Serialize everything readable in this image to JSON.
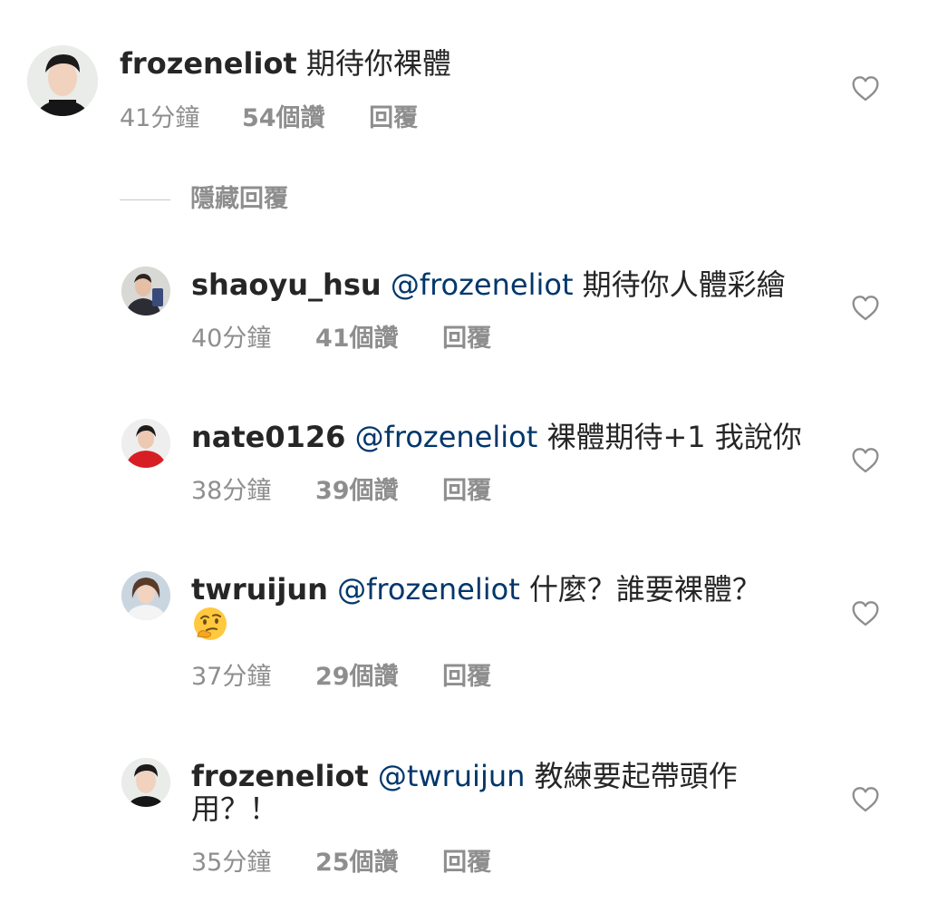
{
  "comments": [
    {
      "username": "frozeneliot",
      "mention": "",
      "text": "期待你裸體",
      "time": "41分鐘",
      "likes": "54個讚",
      "reply": "回覆",
      "avatar": "avatar-frozeneliot"
    },
    {
      "username": "shaoyu_hsu",
      "mention": "@frozeneliot",
      "text": "期待你人體彩繪",
      "time": "40分鐘",
      "likes": "41個讚",
      "reply": "回覆",
      "avatar": "avatar-shaoyu_hsu"
    },
    {
      "username": "nate0126",
      "mention": "@frozeneliot",
      "text": "裸體期待+1 我說你",
      "time": "38分鐘",
      "likes": "39個讚",
      "reply": "回覆",
      "avatar": "avatar-nate0126"
    },
    {
      "username": "twruijun",
      "mention": "@frozeneliot",
      "text": "什麼？誰要裸體？",
      "emoji": "thinking-face-emoji",
      "time": "37分鐘",
      "likes": "29個讚",
      "reply": "回覆",
      "avatar": "avatar-twruijun"
    },
    {
      "username": "frozeneliot",
      "mention": "@twruijun",
      "text": "教練要起帶頭作",
      "text_line2": "用？！",
      "time": "35分鐘",
      "likes": "25個讚",
      "reply": "回覆",
      "avatar": "avatar-frozeneliot"
    }
  ],
  "hide_replies_label": "隱藏回覆",
  "icons": {
    "like": "heart-outline-icon"
  },
  "colors": {
    "username": "#262626",
    "mention": "#00376b",
    "meta": "#8e8e8e",
    "heart_stroke": "#8e8e8e"
  }
}
